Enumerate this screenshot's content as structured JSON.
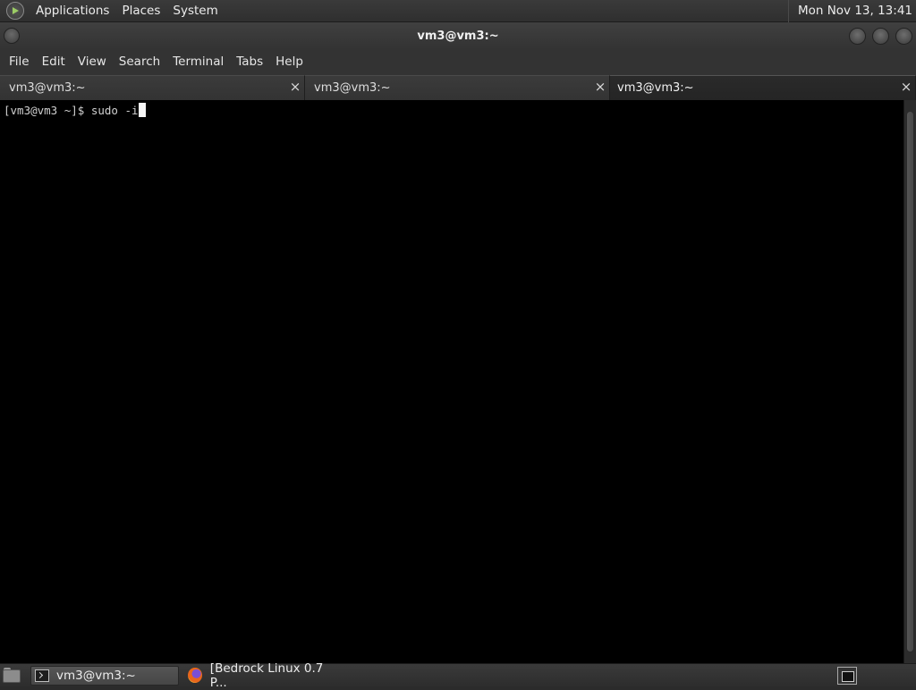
{
  "top_panel": {
    "menus": [
      "Applications",
      "Places",
      "System"
    ],
    "clock": "Mon Nov 13, 13:41"
  },
  "window": {
    "title": "vm3@vm3:~"
  },
  "menubar": {
    "items": [
      "File",
      "Edit",
      "View",
      "Search",
      "Terminal",
      "Tabs",
      "Help"
    ]
  },
  "tabs": [
    {
      "label": "vm3@vm3:~",
      "close": "×",
      "active": false
    },
    {
      "label": "vm3@vm3:~",
      "close": "×",
      "active": false
    },
    {
      "label": "vm3@vm3:~",
      "close": "×",
      "active": true
    }
  ],
  "terminal": {
    "prompt": "[vm3@vm3 ~]$ ",
    "command": "sudo -i"
  },
  "bottom_panel": {
    "tasks": [
      {
        "label": "vm3@vm3:~",
        "icon": "terminal-icon",
        "active": true
      },
      {
        "label": "[Bedrock Linux 0.7 P...",
        "icon": "firefox-icon",
        "active": false
      }
    ]
  },
  "colors": {
    "terminal_bg": "#000000",
    "panel_bg": "#333333",
    "text": "#e8e8e8"
  }
}
